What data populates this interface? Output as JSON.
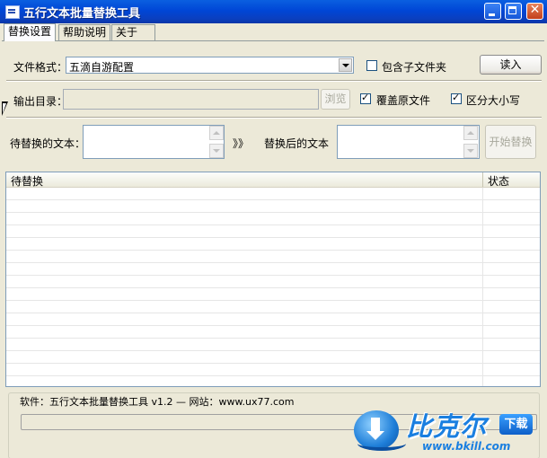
{
  "window": {
    "title": "五行文本批量替换工具"
  },
  "tabs": [
    {
      "label": "替换设置",
      "active": true
    },
    {
      "label": "帮助说明",
      "active": false
    },
    {
      "label": "关于",
      "active": false
    }
  ],
  "settings": {
    "file_format_label": "文件格式：",
    "file_format_value": "五滴自游配置",
    "include_subfolders_label": "包含子文件夹",
    "include_subfolders_checked": false,
    "read_button": "读入",
    "output_dir_label": "输出目录：",
    "output_dir_value": "",
    "browse_button": "浏览",
    "overwrite_label": "覆盖原文件",
    "overwrite_checked": true,
    "case_sensitive_label": "区分大小写",
    "case_sensitive_checked": true,
    "find_label": "待替换的文本：",
    "find_value": "",
    "arrow_text": "》》",
    "replace_label": "替换后的文本",
    "replace_value": "",
    "start_button": "开始替换"
  },
  "list": {
    "columns": [
      "待替换",
      "状态"
    ],
    "rows": []
  },
  "footer": {
    "info": "软件：五行文本批量替换工具 v1.2  — 网站：www.ux77.com",
    "progress": 0
  },
  "watermark": {
    "brand": "比克尔",
    "badge": "下载",
    "url": "www.bkill.com"
  },
  "colors": {
    "titlebar": "#0a5fe0",
    "face": "#ece9d8",
    "field_border": "#7f9db9"
  }
}
